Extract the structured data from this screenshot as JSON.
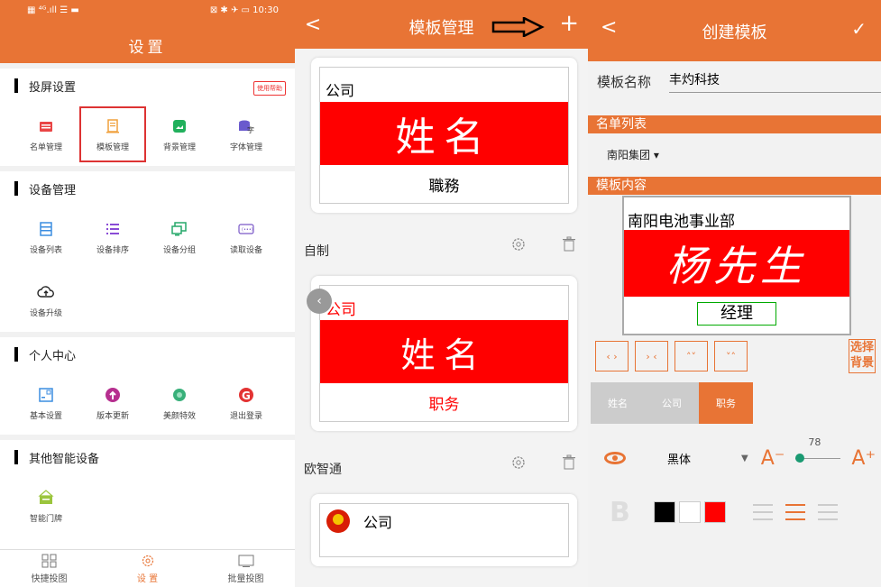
{
  "status": {
    "left": "▦ ⁴ᴳ.ıll ☰ ▬",
    "right": "⊠ ✱ ✈ ▭ 10:30"
  },
  "settings": {
    "title": "设置",
    "sections": [
      {
        "label": "投屏设置",
        "help": "使用帮助",
        "items": [
          {
            "label": "名单管理",
            "color": "#e94545",
            "icon": "list-card-icon"
          },
          {
            "label": "模板管理",
            "color": "#f0a13c",
            "icon": "template-icon",
            "selected": true
          },
          {
            "label": "背景管理",
            "color": "#21b05c",
            "icon": "image-icon"
          },
          {
            "label": "字体管理",
            "color": "#6a5acd",
            "icon": "font-icon"
          }
        ]
      },
      {
        "label": "设备管理",
        "items": [
          {
            "label": "设备列表",
            "color": "#3c8de0",
            "icon": "device-list-icon"
          },
          {
            "label": "设备排序",
            "color": "#8a4bd6",
            "icon": "sort-icon"
          },
          {
            "label": "设备分组",
            "color": "#26a86a",
            "icon": "group-icon"
          },
          {
            "label": "读取设备",
            "color": "#7a58c7",
            "icon": "read-device-icon"
          },
          {
            "label": "设备升级",
            "color": "#222222",
            "icon": "cloud-upload-icon"
          }
        ]
      },
      {
        "label": "个人中心",
        "items": [
          {
            "label": "基本设置",
            "color": "#3c8de0",
            "icon": "basic-settings-icon"
          },
          {
            "label": "版本更新",
            "color": "#b62f8f",
            "icon": "update-icon"
          },
          {
            "label": "美颜特效",
            "color": "#38b07a",
            "icon": "beauty-icon"
          },
          {
            "label": "退出登录",
            "color": "#e33333",
            "icon": "logout-icon"
          }
        ]
      },
      {
        "label": "其他智能设备",
        "items": [
          {
            "label": "智能门牌",
            "color": "#9bc53d",
            "icon": "door-sign-icon"
          }
        ]
      }
    ],
    "tabbar": [
      {
        "label": "快捷投图",
        "icon": "grid-icon"
      },
      {
        "label": "设 置",
        "icon": "gear-icon",
        "active": true
      },
      {
        "label": "批量投图",
        "icon": "screen-icon"
      }
    ]
  },
  "templates": {
    "title": "模板管理",
    "back": "<",
    "add": "+",
    "cards": [
      {
        "company": "公司",
        "name": "姓名",
        "title": "職務",
        "footer": "自制"
      },
      {
        "company": "公司",
        "name": "姓名",
        "title": "职务",
        "footer": "欧智通"
      },
      {
        "company": "公司"
      }
    ]
  },
  "create": {
    "title": "创建模板",
    "back": "<",
    "confirm": "✓",
    "name_label": "模板名称",
    "name_value": "丰灼科技",
    "list_label": "名单列表",
    "list_value": "南阳集团 ▾",
    "content_label": "模板内容",
    "preview": {
      "company": "南阳电池事业部",
      "name": "杨先生",
      "title": "经理"
    },
    "choose_bg": "选择背景",
    "tabs": [
      "姓名",
      "公司",
      "职务"
    ],
    "font": "黑体",
    "font_size": "78",
    "font_size_fraction": 0.0,
    "colors": [
      "#000000",
      "#ffffff",
      "#ff0000"
    ],
    "bold_label": "B",
    "a_minus": "A⁻",
    "a_plus": "A⁺"
  }
}
